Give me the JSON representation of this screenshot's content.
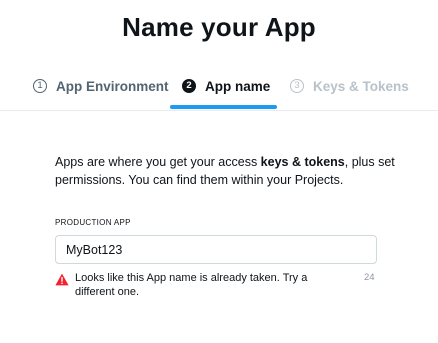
{
  "page": {
    "title": "Name your App"
  },
  "steps": [
    {
      "number": "1",
      "label": "App Environment",
      "state": "completed"
    },
    {
      "number": "2",
      "label": "App name",
      "state": "active"
    },
    {
      "number": "3",
      "label": "Keys & Tokens",
      "state": "upcoming"
    }
  ],
  "description": {
    "before": "Apps are where you get your access ",
    "bold": "keys & tokens",
    "after": ", plus set permissions. You can find them within your Projects."
  },
  "app_name_field": {
    "label": "PRODUCTION APP",
    "value": "MyBot123",
    "error": "Looks like this App name is already taken. Try a different one.",
    "char_count": "24"
  },
  "colors": {
    "accent": "#1d9bf0",
    "error_icon": "#f4212e"
  },
  "icons": {
    "error": "warning-triangle-icon"
  }
}
